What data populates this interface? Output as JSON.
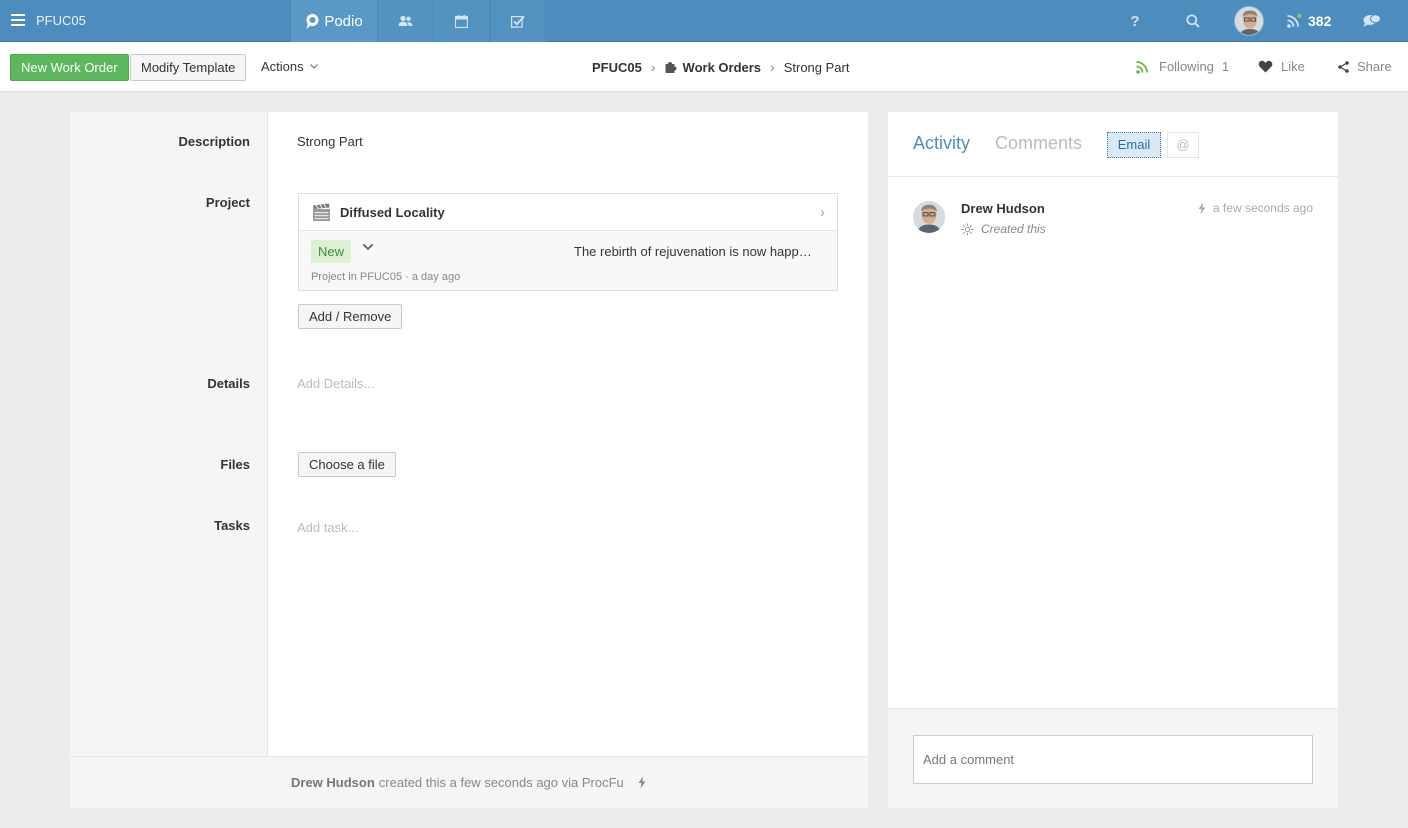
{
  "topbar": {
    "workspace": "PFUC05",
    "brand": "Podio",
    "notification_count": "382"
  },
  "actionbar": {
    "new_item_label": "New Work Order",
    "modify_template_label": "Modify Template",
    "actions_label": "Actions",
    "breadcrumb": {
      "workspace": "PFUC05",
      "app": "Work Orders",
      "item": "Strong Part"
    },
    "following_label": "Following",
    "following_count": "1",
    "like_label": "Like",
    "share_label": "Share"
  },
  "item": {
    "fields": {
      "description_label": "Description",
      "description_value": "Strong Part",
      "project_label": "Project",
      "details_label": "Details",
      "details_placeholder": "Add Details...",
      "files_label": "Files",
      "tasks_label": "Tasks",
      "tasks_placeholder": "Add task..."
    },
    "project": {
      "title": "Diffused Locality",
      "status": "New",
      "summary": "The rebirth of rejuvenation is now happening",
      "meta": "Project in PFUC05 · a day ago"
    },
    "add_remove_label": "Add / Remove",
    "choose_file_label": "Choose a file",
    "footer": {
      "author": "Drew Hudson",
      "text": "created this a few seconds ago via ProcFu"
    }
  },
  "panel": {
    "tabs": {
      "activity": "Activity",
      "comments": "Comments",
      "email": "Email",
      "mention": "@"
    },
    "activity": {
      "user": "Drew Hudson",
      "time": "a few seconds ago",
      "action": "Created this"
    },
    "comment_placeholder": "Add a comment"
  },
  "colors": {
    "topbar": "#4c8dbd",
    "accent_green": "#5cb85c",
    "link_blue": "#4c8dbd"
  }
}
